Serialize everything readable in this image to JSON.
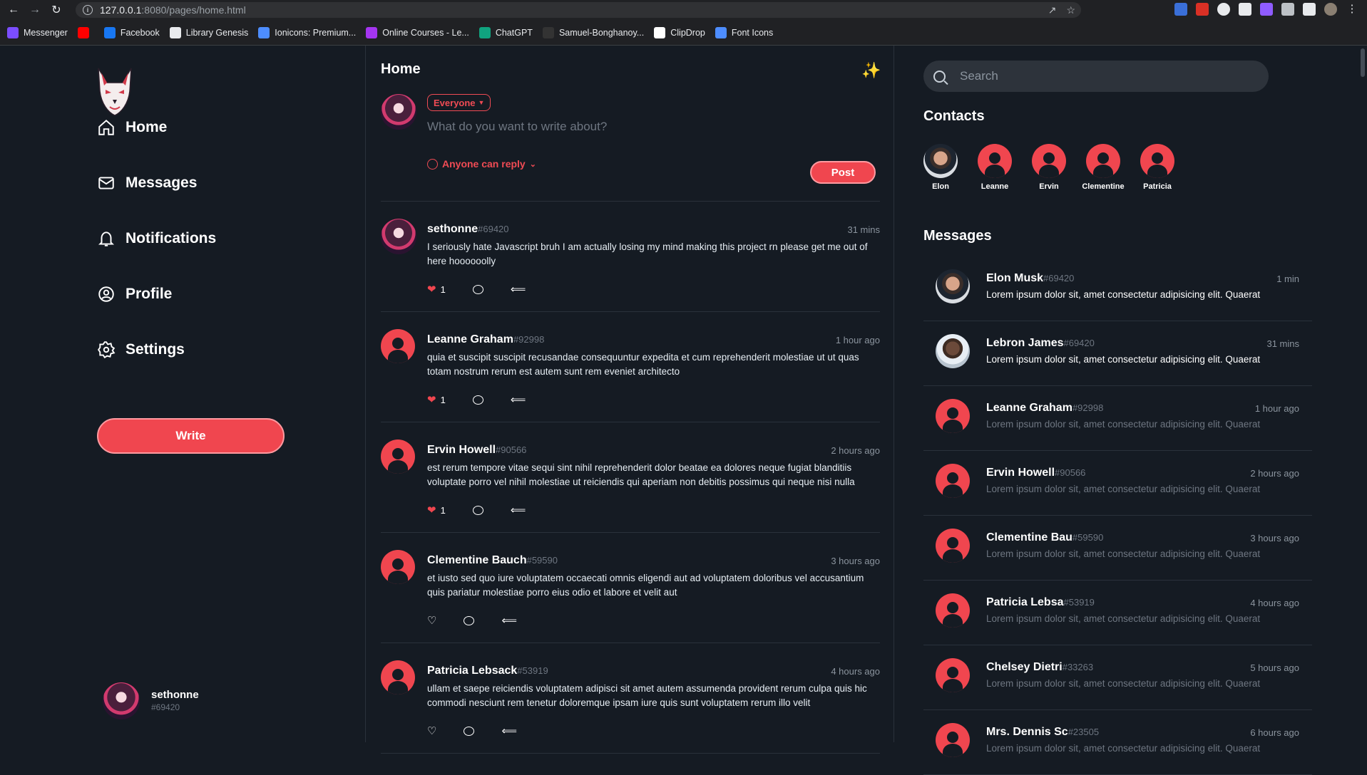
{
  "browser": {
    "url_host": "127.0.0.1",
    "url_path": ":8080/pages/home.html",
    "bookmarks": [
      {
        "label": "Messenger",
        "color": "#7b4dff"
      },
      {
        "label": "",
        "color": "#ff0000"
      },
      {
        "label": "Facebook",
        "color": "#1877f2"
      },
      {
        "label": "Library Genesis",
        "color": "#e8eaed"
      },
      {
        "label": "Ionicons: Premium...",
        "color": "#4d8dff"
      },
      {
        "label": "Online Courses - Le...",
        "color": "#a435f0"
      },
      {
        "label": "ChatGPT",
        "color": "#10a37f"
      },
      {
        "label": "Samuel-Bonghanoy...",
        "color": "#333333"
      },
      {
        "label": "ClipDrop",
        "color": "#ffffff"
      },
      {
        "label": "Font Icons",
        "color": "#4d8dff"
      }
    ]
  },
  "sidebar": {
    "nav": [
      {
        "label": "Home",
        "icon": "home-icon"
      },
      {
        "label": "Messages",
        "icon": "mail-icon"
      },
      {
        "label": "Notifications",
        "icon": "bell-icon"
      },
      {
        "label": "Profile",
        "icon": "user-circle-icon"
      },
      {
        "label": "Settings",
        "icon": "gear-icon"
      }
    ],
    "write_label": "Write",
    "user": {
      "name": "sethonne",
      "tag": "#69420"
    }
  },
  "feed": {
    "title": "Home",
    "composer": {
      "audience": "Everyone",
      "placeholder": "What do you want to write about?",
      "reply_setting": "Anyone can reply",
      "post_label": "Post"
    },
    "posts": [
      {
        "name": "sethonne",
        "tag": "#69420",
        "time": "31 mins",
        "text": "I seriously hate Javascript bruh I am actually losing my mind making this project rn please get me out of here hoooooolly",
        "likes": "1",
        "liked": true
      },
      {
        "name": "Leanne Graham",
        "tag": "#92998",
        "time": "1 hour ago",
        "text": "quia et suscipit suscipit recusandae consequuntur expedita et cum reprehenderit molestiae ut ut quas totam nostrum rerum est autem sunt rem eveniet architecto",
        "likes": "1",
        "liked": true
      },
      {
        "name": "Ervin Howell",
        "tag": "#90566",
        "time": "2 hours ago",
        "text": "est rerum tempore vitae sequi sint nihil reprehenderit dolor beatae ea dolores neque fugiat blanditiis voluptate porro vel nihil molestiae ut reiciendis qui aperiam non debitis possimus qui neque nisi nulla",
        "likes": "1",
        "liked": true
      },
      {
        "name": "Clementine Bauch",
        "tag": "#59590",
        "time": "3 hours ago",
        "text": "et iusto sed quo iure voluptatem occaecati omnis eligendi aut ad voluptatem doloribus vel accusantium quis pariatur molestiae porro eius odio et labore et velit aut",
        "likes": "",
        "liked": false
      },
      {
        "name": "Patricia Lebsack",
        "tag": "#53919",
        "time": "4 hours ago",
        "text": "ullam et saepe reiciendis voluptatem adipisci sit amet autem assumenda provident rerum culpa quis hic commodi nesciunt rem tenetur doloremque ipsam iure quis sunt voluptatem rerum illo velit",
        "likes": "",
        "liked": false
      }
    ]
  },
  "rightbar": {
    "search_placeholder": "Search",
    "contacts_title": "Contacts",
    "contacts": [
      "Elon",
      "Leanne",
      "Ervin",
      "Clementine",
      "Patricia"
    ],
    "messages_title": "Messages",
    "messages": [
      {
        "name": "Elon Musk",
        "tag": "#69420",
        "time": "1 min",
        "text": "Lorem ipsum dolor sit, amet consectetur adipisicing elit. Quaerat",
        "read": true,
        "avatar": "elon"
      },
      {
        "name": "Lebron James",
        "tag": "#69420",
        "time": "31 mins",
        "text": "Lorem ipsum dolor sit, amet consectetur adipisicing elit. Quaerat",
        "read": true,
        "avatar": "lebron"
      },
      {
        "name": "Leanne Graham",
        "tag": "#92998",
        "time": "1 hour ago",
        "text": "Lorem ipsum dolor sit, amet consectetur adipisicing elit. Quaerat",
        "read": false,
        "avatar": "user"
      },
      {
        "name": "Ervin Howell",
        "tag": "#90566",
        "time": "2 hours ago",
        "text": "Lorem ipsum dolor sit, amet consectetur adipisicing elit. Quaerat",
        "read": false,
        "avatar": "user"
      },
      {
        "name": "Clementine Bau",
        "tag": "#59590",
        "time": "3 hours ago",
        "text": "Lorem ipsum dolor sit, amet consectetur adipisicing elit. Quaerat",
        "read": false,
        "avatar": "user"
      },
      {
        "name": "Patricia Lebsa",
        "tag": "#53919",
        "time": "4 hours ago",
        "text": "Lorem ipsum dolor sit, amet consectetur adipisicing elit. Quaerat",
        "read": false,
        "avatar": "user"
      },
      {
        "name": "Chelsey Dietri",
        "tag": "#33263",
        "time": "5 hours ago",
        "text": "Lorem ipsum dolor sit, amet consectetur adipisicing elit. Quaerat",
        "read": false,
        "avatar": "user"
      },
      {
        "name": "Mrs. Dennis Sc",
        "tag": "#23505",
        "time": "6 hours ago",
        "text": "Lorem ipsum dolor sit, amet consectetur adipisicing elit. Quaerat",
        "read": false,
        "avatar": "user"
      }
    ]
  },
  "colors": {
    "accent": "#f0464f",
    "background": "#151b23",
    "muted": "#6e7681"
  }
}
